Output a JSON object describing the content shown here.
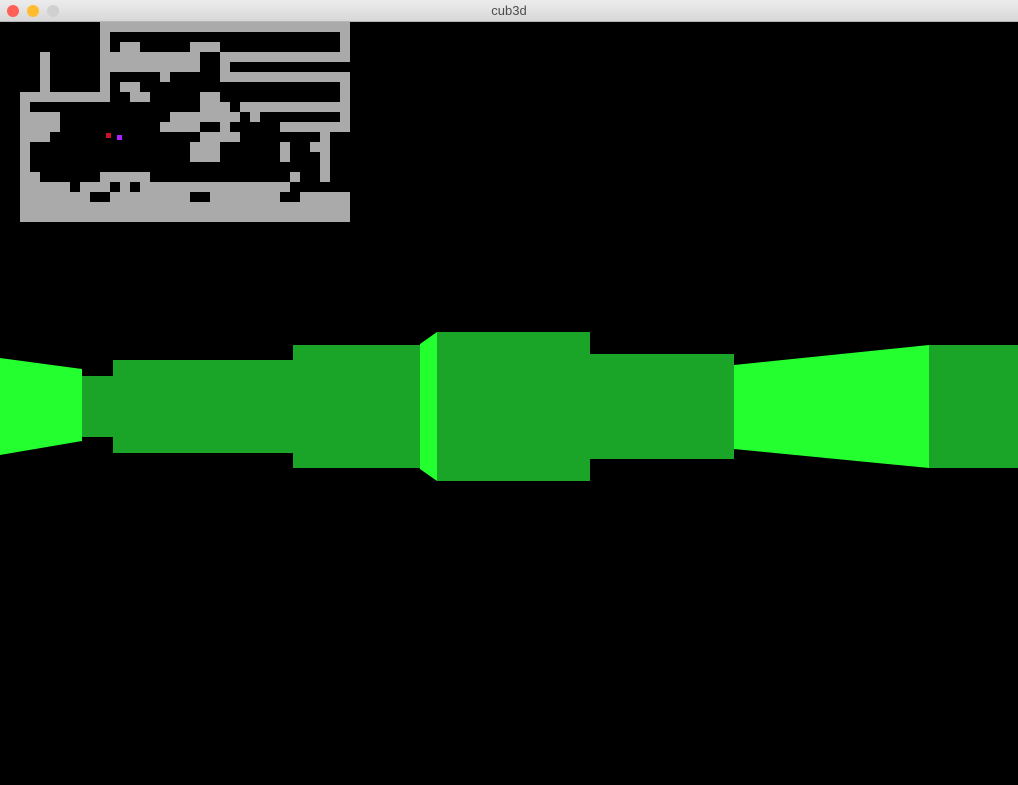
{
  "window": {
    "title": "cub3d",
    "traffic_lights": {
      "close_color": "#fe5f57",
      "minimize_color": "#febc2e",
      "zoom_color": "#d0d0d0"
    }
  },
  "colors": {
    "background": "#000000",
    "wall_dark": "#1aa528",
    "wall_bright": "#24ff30",
    "minimap_wall": "#aaaaaa",
    "player_marker": "#aa22ff",
    "direction_marker": "#cc1122"
  },
  "minimap": {
    "rows": [
      "00000000001111111111111111111111111",
      "00000000001000000000000000000000001",
      "00000000001011000001110000000000001",
      "00001000001111111111001111111111111",
      "00001000001111111111001000000000000",
      "00001000001000001000001111111111111",
      "00001000001011000000000000000000001",
      "00111111111001100000110000000000001",
      "00100000000000000000111011111111111",
      "00111100000000000111111101000000001",
      "00111100000000001111001000001111111",
      "00111000000000000000111100000000100",
      "00100000000000000001110000001001100",
      "00100000000000000001110000001000100",
      "00100000000000000000000000000000100",
      "00110000001111100000000000000100100",
      "00111110111010111111111111111000000",
      "00111111100111111110011111110011111",
      "00111111111111111111111111111111111",
      "00111111111111111111111111111111111"
    ]
  }
}
